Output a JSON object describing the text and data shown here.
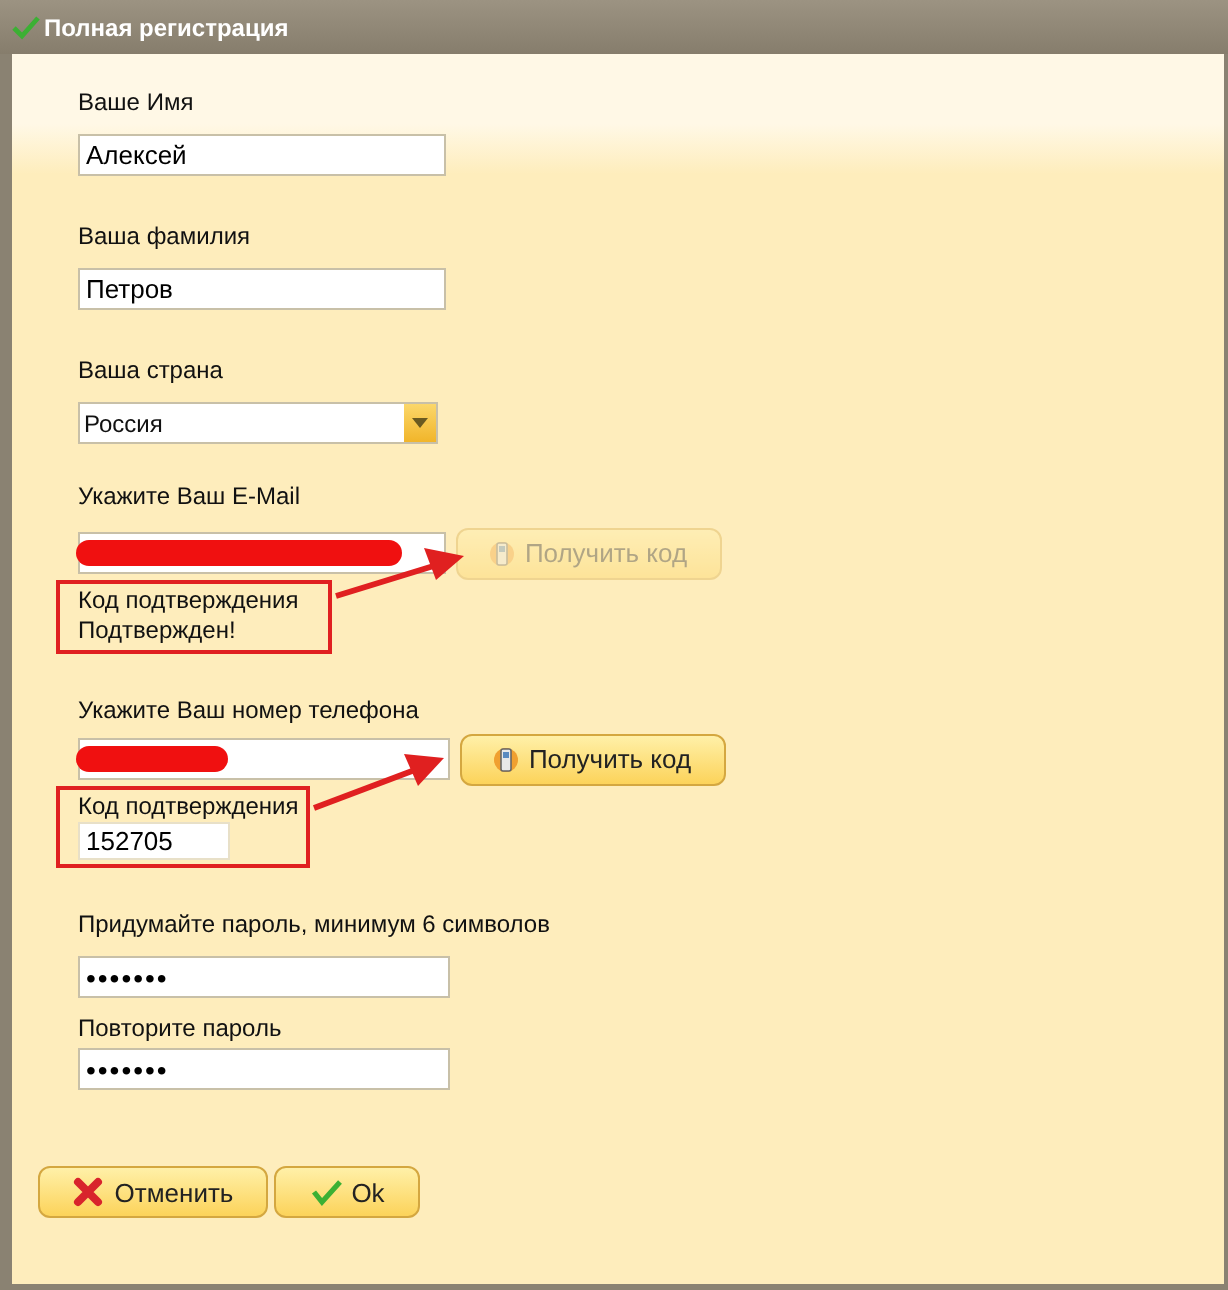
{
  "window": {
    "title": "Полная регистрация"
  },
  "fields": [
    {
      "kind": "text",
      "label": "Ваше Имя",
      "value": "Алексей"
    },
    {
      "kind": "text",
      "label": "Ваша фамилия",
      "value": "Петров"
    },
    {
      "kind": "select",
      "label": "Ваша страна",
      "value": "Россия"
    }
  ],
  "email": {
    "label": "Укажите Ваш E-Mail",
    "redacted": true,
    "button": {
      "label": "Получить код",
      "disabled": true
    },
    "confirmation": {
      "label": "Код подтверждения",
      "status": "Подтвержден!"
    }
  },
  "phone": {
    "label": "Укажите Ваш номер телефона",
    "redacted": true,
    "button": {
      "label": "Получить код",
      "disabled": false
    },
    "confirmation": {
      "label": "Код подтверждения",
      "value": "152705"
    }
  },
  "password": {
    "label": "Придумайте пароль, минимум 6 символов",
    "value": "•••••••",
    "repeat_label": "Повторите пароль",
    "repeat_value": "•••••••"
  },
  "buttons": [
    {
      "kind": "cancel",
      "label": "Отменить"
    },
    {
      "kind": "ok",
      "label": "Ok"
    }
  ]
}
